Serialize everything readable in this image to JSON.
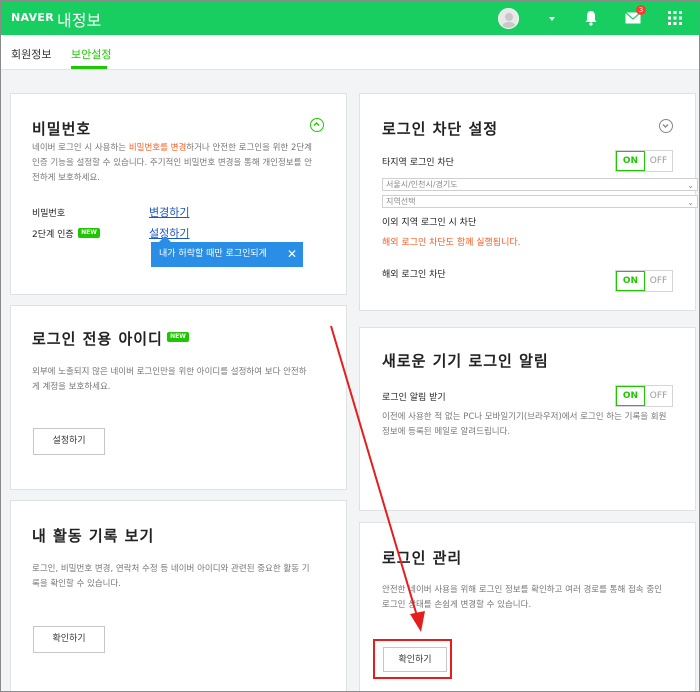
{
  "header": {
    "logo": "NAVER",
    "title": "내정보",
    "mail_badge": "3"
  },
  "tabs": [
    {
      "label": "회원정보"
    },
    {
      "label": "보안설정"
    }
  ],
  "password": {
    "title": "비밀번호",
    "desc_1": "네이버 로그인 시 사용하는 ",
    "desc_hl": "비밀번호를 변경",
    "desc_2": "하거나 안전한 로그인을 위한 2단계",
    "desc_3": "인증 기능을 설정할 수 있습니다. 주기적인 비밀번호 변경을 통해 개인정보를 안",
    "desc_4": "전하게 보호하세요.",
    "row1_label": "비밀번호",
    "row1_link": "변경하기",
    "row2_label": "2단계 인증",
    "row2_badge": "NEW",
    "row2_link": "설정하기",
    "tooltip": "내가 허락할 때만 로그인되게",
    "tooltip_close": "✕"
  },
  "login_id": {
    "title": "로그인 전용 아이디",
    "badge": "NEW",
    "desc_1": "외부에 노출되지 않은 네이버 로그인만을 위한 아이디를 설정하여 보다 안전하",
    "desc_2": "게 계정을 보호하세요.",
    "button": "설정하기"
  },
  "activity": {
    "title": "내 활동 기록 보기",
    "desc_1": "로그인, 비밀번호 변경, 연락처 수정 등 네이버 아이디와 관련된 중요한 활동 기",
    "desc_2": "록을 확인할 수 있습니다.",
    "button": "확인하기"
  },
  "block": {
    "title": "로그인 차단 설정",
    "region_label": "타지역 로그인 차단",
    "toggle_on": "ON",
    "toggle_off": "OFF",
    "select1": "서울시/인천시/경기도",
    "select2": "지역선택",
    "other_text": "이외 지역 로그인 시 차단",
    "warning": "해외 로그인 차단도 함께 실행됩니다.",
    "overseas_label": "해외 로그인 차단",
    "toggle2_on": "ON",
    "toggle2_off": "OFF"
  },
  "new_device": {
    "title": "새로운 기기 로그인 알림",
    "label": "로그인 알림 받기",
    "toggle_on": "ON",
    "toggle_off": "OFF",
    "desc_1": "이전에 사용한 적 없는 PC나 모바일기기(브라우저)에서 로그인 하는 기록을 회원",
    "desc_2": "정보에 등록된 메일로 알려드립니다."
  },
  "manage": {
    "title": "로그인 관리",
    "desc_1": "안전한 네이버 사용을 위해 로그인 정보를 확인하고 여러 경로를 통해 접속 중인",
    "desc_2": "로그인 상태를 손쉽게 변경할 수 있습니다.",
    "button": "확인하기"
  },
  "colors": {
    "brand": "#19ce60",
    "accent": "#1ec800",
    "link": "#1e55c8",
    "highlight": "#ff5a1f",
    "annotation": "#e51d1d"
  }
}
